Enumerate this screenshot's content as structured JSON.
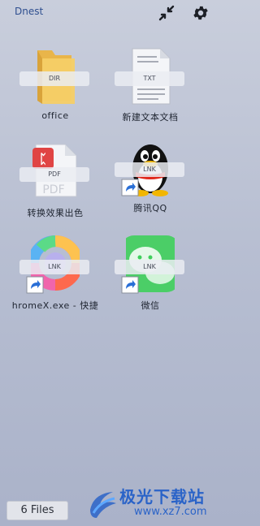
{
  "header": {
    "title": "Dnest",
    "collapse_icon": "collapse-arrows-icon",
    "settings_icon": "gear-icon"
  },
  "tiles": [
    {
      "name": "office",
      "type": "DIR",
      "icon": "folder-icon",
      "shortcut": false
    },
    {
      "name": "新建文本文档",
      "type": "TXT",
      "icon": "text-document-icon",
      "shortcut": false
    },
    {
      "name": "转换效果出色",
      "type": "PDF",
      "icon": "pdf-icon",
      "shortcut": false
    },
    {
      "name": "腾讯QQ",
      "type": "LNK",
      "icon": "qq-penguin-icon",
      "shortcut": true
    },
    {
      "name": "hromeX.exe - 快捷",
      "type": "LNK",
      "icon": "colorful-ring-app-icon",
      "shortcut": true
    },
    {
      "name": "微信",
      "type": "LNK",
      "icon": "wechat-icon",
      "shortcut": true
    }
  ],
  "footer": {
    "file_count": "6 Files"
  },
  "watermark": {
    "text": "极光下载站",
    "url": "www.xz7.com"
  },
  "colors": {
    "title": "#2f4f8f",
    "watermark": "#2a63c8",
    "background_top": "#c9cedc",
    "background_bottom": "#aab2c9"
  }
}
